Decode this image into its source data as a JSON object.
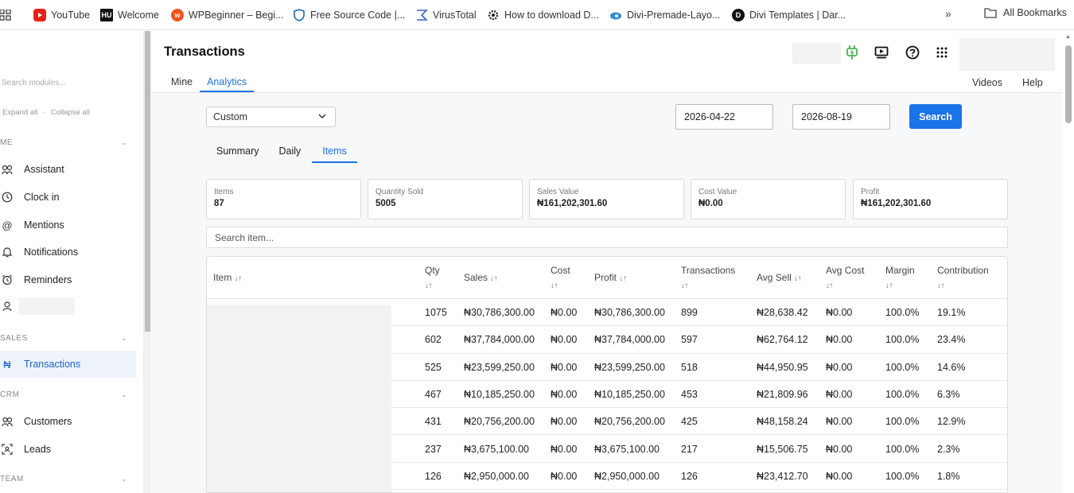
{
  "bookmarks": {
    "items": [
      {
        "label": "YouTube",
        "icon": "youtube-icon",
        "color": "#e62117"
      },
      {
        "label": "Welcome",
        "icon": "hu-icon",
        "color": "#111111"
      },
      {
        "label": "WPBeginner – Begi...",
        "icon": "wpbeginner-icon",
        "color": "#f0541e"
      },
      {
        "label": "Free Source Code |...",
        "icon": "shield-icon",
        "color": "#1a6bbd"
      },
      {
        "label": "VirusTotal",
        "icon": "virustotal-icon",
        "color": "#3b61d1"
      },
      {
        "label": "How to download D...",
        "icon": "gear-icon",
        "color": "#222222"
      },
      {
        "label": "Divi-Premade-Layo...",
        "icon": "divi-premade-icon",
        "color": "#2b8ad4"
      },
      {
        "label": "Divi Templates | Dar...",
        "icon": "divi-templates-icon",
        "color": "#111111"
      }
    ],
    "more": "»",
    "all_bookmarks": "All Bookmarks"
  },
  "sidebar": {
    "search_placeholder": "Search modules...",
    "expand_all": "Expand all",
    "separator": "·",
    "collapse_all": "Collapse all",
    "sections": [
      {
        "label": "ME"
      },
      {
        "label": "SALES"
      },
      {
        "label": "CRM"
      },
      {
        "label": "TEAM"
      }
    ],
    "items": [
      {
        "label": "Assistant",
        "icon": "assistant-icon"
      },
      {
        "label": "Clock in",
        "icon": "clock-icon"
      },
      {
        "label": "Mentions",
        "icon": "at-icon"
      },
      {
        "label": "Notifications",
        "icon": "bell-icon"
      },
      {
        "label": "Reminders",
        "icon": "alarm-icon"
      },
      {
        "label": "",
        "icon": "user-icon"
      },
      {
        "label": "Transactions",
        "icon": "naira-icon"
      },
      {
        "label": "Customers",
        "icon": "customers-icon"
      },
      {
        "label": "Leads",
        "icon": "leads-icon"
      }
    ]
  },
  "header": {
    "title": "Transactions",
    "tabs": [
      "Mine",
      "Analytics"
    ],
    "links": [
      "Videos",
      "Help"
    ]
  },
  "filters": {
    "range": "Custom",
    "start_date": "2026-04-22",
    "end_date": "2026-08-19",
    "search_label": "Search"
  },
  "subtabs": [
    "Summary",
    "Daily",
    "Items"
  ],
  "stats": [
    {
      "label": "Items",
      "value": "87"
    },
    {
      "label": "Quantity Sold",
      "value": "5005"
    },
    {
      "label": "Sales Value",
      "value": "₦161,202,301.60"
    },
    {
      "label": "Cost Value",
      "value": "₦0.00"
    },
    {
      "label": "Profit",
      "value": "₦161,202,301.60"
    }
  ],
  "item_search_placeholder": "Search item...",
  "table": {
    "sort_symbol": "↓↑",
    "headers": [
      "Item",
      "Qty",
      "Sales",
      "Cost",
      "Profit",
      "Transactions",
      "Avg Sell",
      "Avg Cost",
      "Margin",
      "Contribution"
    ],
    "rows": [
      [
        "1075",
        "₦30,786,300.00",
        "₦0.00",
        "₦30,786,300.00",
        "899",
        "₦28,638.42",
        "₦0.00",
        "100.0%",
        "19.1%"
      ],
      [
        "602",
        "₦37,784,000.00",
        "₦0.00",
        "₦37,784,000.00",
        "597",
        "₦62,764.12",
        "₦0.00",
        "100.0%",
        "23.4%"
      ],
      [
        "525",
        "₦23,599,250.00",
        "₦0.00",
        "₦23,599,250.00",
        "518",
        "₦44,950.95",
        "₦0.00",
        "100.0%",
        "14.6%"
      ],
      [
        "467",
        "₦10,185,250.00",
        "₦0.00",
        "₦10,185,250.00",
        "453",
        "₦21,809.96",
        "₦0.00",
        "100.0%",
        "6.3%"
      ],
      [
        "431",
        "₦20,756,200.00",
        "₦0.00",
        "₦20,756,200.00",
        "425",
        "₦48,158.24",
        "₦0.00",
        "100.0%",
        "12.9%"
      ],
      [
        "237",
        "₦3,675,100.00",
        "₦0.00",
        "₦3,675,100.00",
        "217",
        "₦15,506.75",
        "₦0.00",
        "100.0%",
        "2.3%"
      ],
      [
        "126",
        "₦2,950,000.00",
        "₦0.00",
        "₦2,950,000.00",
        "126",
        "₦23,412.70",
        "₦0.00",
        "100.0%",
        "1.8%"
      ]
    ]
  },
  "colors": {
    "accent": "#1a73e8",
    "active_bg": "#eef3fb",
    "power_icon": "#4caf50"
  }
}
